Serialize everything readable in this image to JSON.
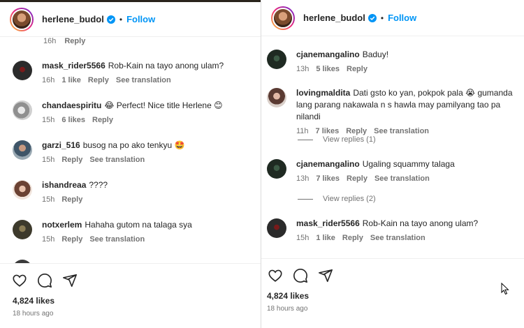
{
  "left": {
    "username": "herlene_budol",
    "dot": "•",
    "follow": "Follow",
    "top_partial": {
      "time": "16h",
      "reply": "Reply"
    },
    "comments": [
      {
        "user": "mask_rider5566",
        "text": "Rob-Kain na tayo anong ulam?",
        "time": "16h",
        "likes": "1 like",
        "reply": "Reply",
        "translate": "See translation",
        "avatar_color": "#2b2b2b"
      },
      {
        "user": "chandaespiritu",
        "text": "😂 Perfect! Nice title Herlene 😊",
        "time": "15h",
        "likes": "6 likes",
        "reply": "Reply",
        "translate": "",
        "avatar_color": "#b9b9b9"
      },
      {
        "user": "garzi_516",
        "text": "busog na po ako tenkyu 🤩",
        "time": "15h",
        "likes": "",
        "reply": "Reply",
        "translate": "See translation",
        "avatar_color": "#6d7d8a"
      },
      {
        "user": "ishandreaa",
        "text": "????",
        "time": "15h",
        "likes": "",
        "reply": "Reply",
        "translate": "",
        "avatar_color": "#c8a594"
      },
      {
        "user": "notxerlem",
        "text": "Hahaha gutom na talaga sya",
        "time": "15h",
        "likes": "",
        "reply": "Reply",
        "translate": "See translation",
        "avatar_color": "#4a4636"
      }
    ],
    "likes_count": "4,824 likes",
    "time_ago": "18 hours ago"
  },
  "right": {
    "username": "herlene_budol",
    "dot": "•",
    "follow": "Follow",
    "comments": [
      {
        "user": "cjanemangalino",
        "text": "Baduy!",
        "time": "13h",
        "likes": "5 likes",
        "reply": "Reply",
        "translate": "",
        "avatar_color": "#1f2a22"
      },
      {
        "user": "lovingmaldita",
        "text": "Dati gsto ko yan, pokpok pala 😭 gumanda lang parang nakawala n s hawla may pamilyang tao pa nilandi",
        "time": "11h",
        "likes": "7 likes",
        "reply": "Reply",
        "translate": "See translation",
        "avatar_color": "#b28d86"
      },
      {
        "user": "cjanemangalino",
        "text": "Ugaling squammy talaga",
        "time": "13h",
        "likes": "7 likes",
        "reply": "Reply",
        "translate": "See translation",
        "avatar_color": "#1f2a22"
      },
      {
        "user": "mask_rider5566",
        "text": "Rob-Kain na tayo anong ulam?",
        "time": "15h",
        "likes": "1 like",
        "reply": "Reply",
        "translate": "See translation",
        "avatar_color": "#2b2b2b"
      }
    ],
    "view_replies_1": "View replies (1)",
    "view_replies_2": "View replies (2)",
    "likes_count": "4,824 likes",
    "time_ago": "18 hours ago"
  },
  "icons": [
    "verified-badge-icon",
    "heart-icon",
    "comment-icon",
    "share-icon",
    "mouse-cursor-icon"
  ],
  "colors": {
    "follow": "#0095f6",
    "muted": "#737373",
    "text": "#262626"
  }
}
